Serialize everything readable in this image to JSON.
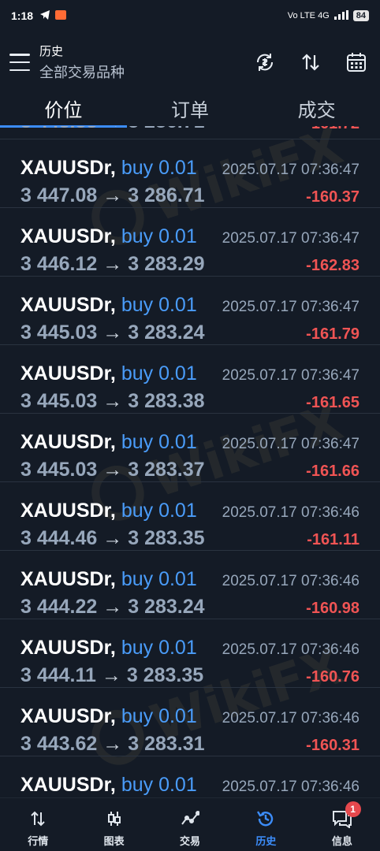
{
  "status_bar": {
    "time": "1:18",
    "network": "Vo LTE 4G",
    "battery": "84"
  },
  "header": {
    "title": "历史",
    "subtitle": "全部交易品种",
    "actions": [
      "sync-icon",
      "sort-icon",
      "calendar-icon"
    ]
  },
  "tabs": [
    {
      "label": "价位",
      "active": true
    },
    {
      "label": "订单",
      "active": false
    },
    {
      "label": "成交",
      "active": false
    }
  ],
  "deals": [
    {
      "symbol": "XAUUSDr,",
      "side": "buy 0.01",
      "open": "3 447.08",
      "close": "3 286.71",
      "time": "2025.07.17 07:36:47",
      "profit": "-160.37"
    },
    {
      "symbol": "XAUUSDr,",
      "side": "buy 0.01",
      "open": "3 446.12",
      "close": "3 283.29",
      "time": "2025.07.17 07:36:47",
      "profit": "-162.83"
    },
    {
      "symbol": "XAUUSDr,",
      "side": "buy 0.01",
      "open": "3 445.03",
      "close": "3 283.24",
      "time": "2025.07.17 07:36:47",
      "profit": "-161.79"
    },
    {
      "symbol": "XAUUSDr,",
      "side": "buy 0.01",
      "open": "3 445.03",
      "close": "3 283.38",
      "time": "2025.07.17 07:36:47",
      "profit": "-161.65"
    },
    {
      "symbol": "XAUUSDr,",
      "side": "buy 0.01",
      "open": "3 445.03",
      "close": "3 283.37",
      "time": "2025.07.17 07:36:47",
      "profit": "-161.66"
    },
    {
      "symbol": "XAUUSDr,",
      "side": "buy 0.01",
      "open": "3 444.46",
      "close": "3 283.35",
      "time": "2025.07.17 07:36:46",
      "profit": "-161.11"
    },
    {
      "symbol": "XAUUSDr,",
      "side": "buy 0.01",
      "open": "3 444.22",
      "close": "3 283.24",
      "time": "2025.07.17 07:36:46",
      "profit": "-160.98"
    },
    {
      "symbol": "XAUUSDr,",
      "side": "buy 0.01",
      "open": "3 444.11",
      "close": "3 283.35",
      "time": "2025.07.17 07:36:46",
      "profit": "-160.76"
    },
    {
      "symbol": "XAUUSDr,",
      "side": "buy 0.01",
      "open": "3 443.62",
      "close": "3 283.31",
      "time": "2025.07.17 07:36:46",
      "profit": "-160.31"
    },
    {
      "symbol": "XAUUSDr,",
      "side": "buy 0.01",
      "open": "",
      "close": "",
      "time": "2025.07.17 07:36:46",
      "profit": ""
    }
  ],
  "arrow": "→",
  "bottom_nav": [
    {
      "label": "行情",
      "icon": "quotes-icon",
      "active": false
    },
    {
      "label": "图表",
      "icon": "chart-icon",
      "active": false
    },
    {
      "label": "交易",
      "icon": "trade-icon",
      "active": false
    },
    {
      "label": "历史",
      "icon": "history-icon",
      "active": true
    },
    {
      "label": "信息",
      "icon": "messages-icon",
      "active": false,
      "badge": "1"
    }
  ],
  "watermark": "WikiFX",
  "colors": {
    "background": "#141b26",
    "accent": "#3c8dfa",
    "loss": "#f05454",
    "buy": "#4a9cf9"
  }
}
